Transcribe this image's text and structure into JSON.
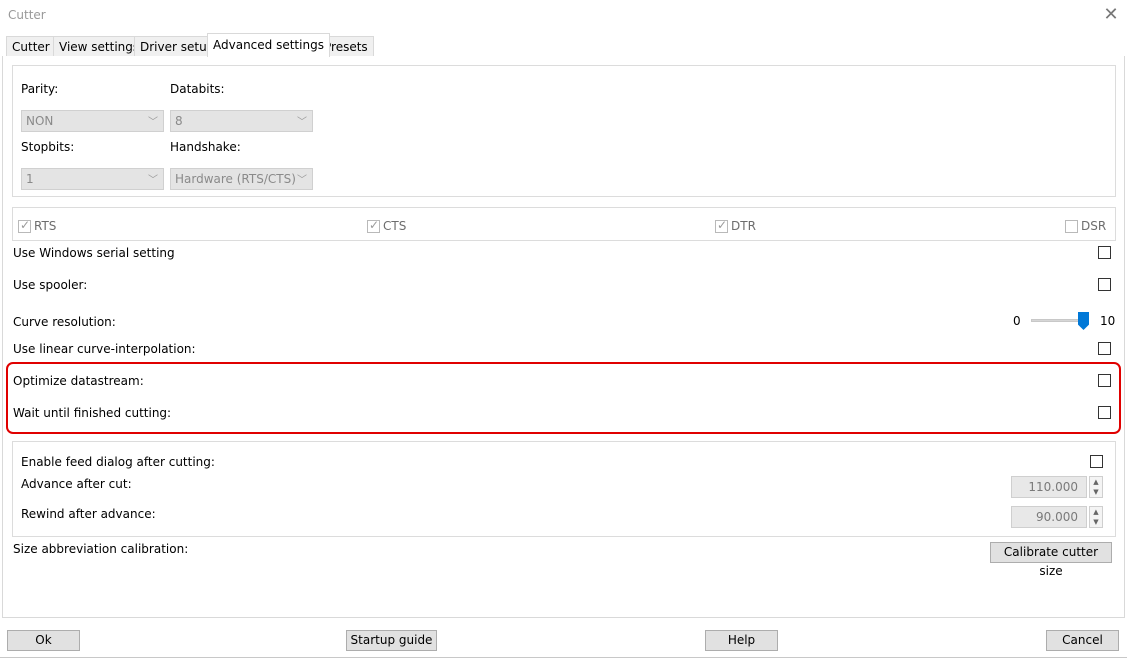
{
  "window": {
    "title": "Cutter",
    "close_icon": "close-icon"
  },
  "tabs": [
    {
      "label": "Cutter"
    },
    {
      "label": "View settings"
    },
    {
      "label": "Driver setup"
    },
    {
      "label": "Advanced settings",
      "active": true
    },
    {
      "label": "Presets"
    }
  ],
  "serial": {
    "parity_label": "Parity:",
    "parity_value": "NON",
    "databits_label": "Databits:",
    "databits_value": "8",
    "stopbits_label": "Stopbits:",
    "stopbits_value": "1",
    "handshake_label": "Handshake:",
    "handshake_value": "Hardware (RTS/CTS)"
  },
  "lines": {
    "rts": {
      "label": "RTS",
      "checked": true
    },
    "cts": {
      "label": "CTS",
      "checked": true
    },
    "dtr": {
      "label": "DTR",
      "checked": true
    },
    "dsr": {
      "label": "DSR",
      "checked": false
    }
  },
  "options": {
    "use_windows_serial": "Use Windows serial setting",
    "use_spooler": "Use spooler:",
    "curve_resolution": "Curve resolution:",
    "curve_min": "0",
    "curve_max": "10",
    "curve_value": 10,
    "linear_interp": "Use linear curve-interpolation:",
    "optimize": "Optimize datastream:",
    "wait_finished": "Wait until finished cutting:"
  },
  "feed": {
    "enable_label": "Enable feed dialog after cutting:",
    "advance_label": "Advance after cut:",
    "advance_value": "110.000",
    "rewind_label": "Rewind after advance:",
    "rewind_value": "90.000"
  },
  "calibration": {
    "label": "Size abbreviation calibration:",
    "button": "Calibrate cutter size"
  },
  "footer": {
    "ok": "Ok",
    "startup": "Startup guide",
    "help": "Help",
    "cancel": "Cancel"
  },
  "annotation_color": "#e00000"
}
